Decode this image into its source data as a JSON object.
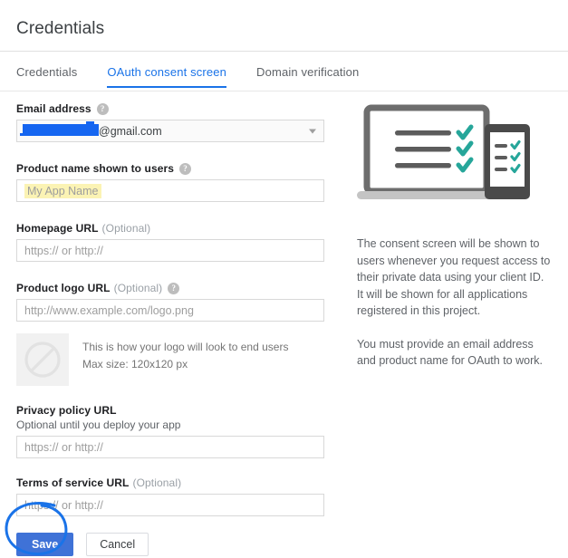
{
  "header": {
    "title": "Credentials"
  },
  "tabs": [
    {
      "label": "Credentials",
      "active": false
    },
    {
      "label": "OAuth consent screen",
      "active": true
    },
    {
      "label": "Domain verification",
      "active": false
    }
  ],
  "form": {
    "email": {
      "label": "Email address",
      "help_icon": "help-icon",
      "value_visible": "@gmail.com",
      "redacted": true,
      "caret_icon": "chevron-down-icon"
    },
    "product_name": {
      "label": "Product name shown to users",
      "help_icon": "help-icon",
      "placeholder": "My App Name",
      "highlight_color": "#fbf3b4"
    },
    "homepage_url": {
      "label": "Homepage URL",
      "optional": "(Optional)",
      "placeholder": "https:// or http://"
    },
    "product_logo_url": {
      "label": "Product logo URL",
      "optional": "(Optional)",
      "help_icon": "help-icon",
      "placeholder": "http://www.example.com/logo.png"
    },
    "logo_preview": {
      "icon": "no-entry-icon",
      "line1": "This is how your logo will look to end users",
      "line2": "Max size: 120x120 px"
    },
    "privacy_policy_url": {
      "label": "Privacy policy URL",
      "sub_label": "Optional until you deploy your app",
      "placeholder": "https:// or http://"
    },
    "terms_of_service_url": {
      "label": "Terms of service URL",
      "optional": "(Optional)",
      "placeholder": "https:// or http://"
    }
  },
  "actions": {
    "save_label": "Save",
    "cancel_label": "Cancel",
    "save_color": "#3f72d7",
    "annotation_color": "#1a73e8"
  },
  "sidebar": {
    "illustration_icon": "laptop-and-phone-checklist-illustration",
    "paragraph_1": "The consent screen will be shown to users whenever you request access to their private data using your client ID. It will be shown for all applications registered in this project.",
    "paragraph_2": "You must provide an email address and product name for OAuth to work."
  }
}
